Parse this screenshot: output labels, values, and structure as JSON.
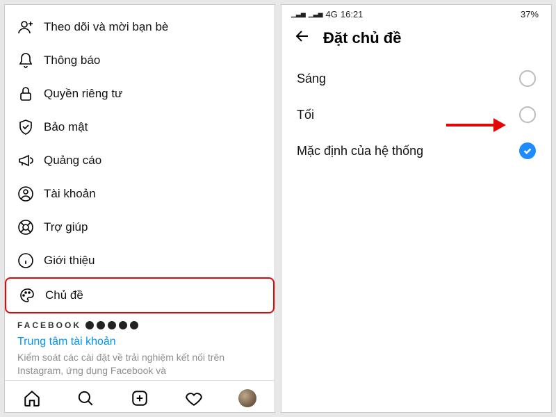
{
  "left": {
    "menu": [
      {
        "label": "Theo dõi và mời bạn bè"
      },
      {
        "label": "Thông báo"
      },
      {
        "label": "Quyền riêng tư"
      },
      {
        "label": "Bảo mật"
      },
      {
        "label": "Quảng cáo"
      },
      {
        "label": "Tài khoản"
      },
      {
        "label": "Trợ giúp"
      },
      {
        "label": "Giới thiệu"
      },
      {
        "label": "Chủ đề"
      }
    ],
    "facebook_logo": "FACEBOOK",
    "accounts_center": "Trung tâm tài khoản",
    "description": "Kiểm soát các cài đặt về trải nghiệm kết nối trên Instagram, ứng dụng Facebook và"
  },
  "right": {
    "status": {
      "net": "4G",
      "time": "16:21",
      "battery_pct": "37%"
    },
    "header_title": "Đặt chủ đề",
    "options": [
      {
        "label": "Sáng",
        "selected": false
      },
      {
        "label": "Tối",
        "selected": false
      },
      {
        "label": "Mặc định của hệ thống",
        "selected": true
      }
    ]
  }
}
